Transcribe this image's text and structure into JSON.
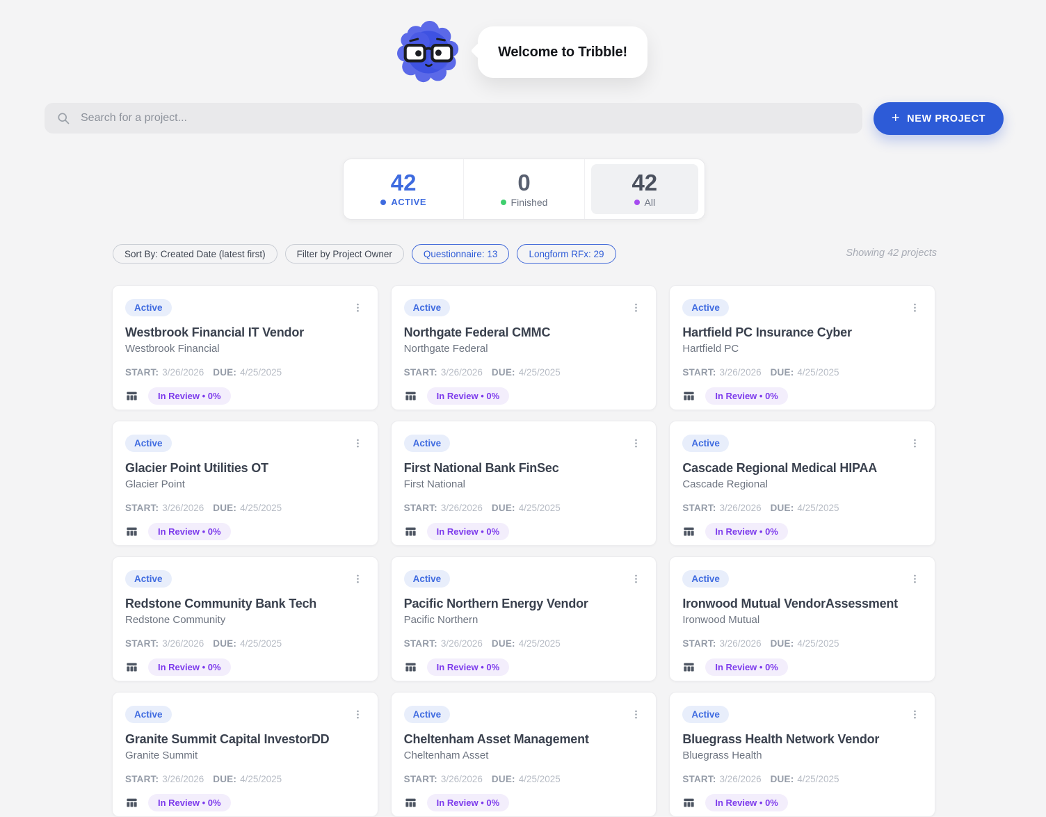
{
  "header": {
    "welcome_text": "Welcome to Tribble!"
  },
  "toolbar": {
    "search_placeholder": "Search for a project...",
    "new_project_label": "NEW PROJECT",
    "plus_glyph": "+"
  },
  "stats": {
    "active": {
      "value": "42",
      "label": "ACTIVE"
    },
    "finished": {
      "value": "0",
      "label": "Finished"
    },
    "all": {
      "value": "42",
      "label": "All"
    }
  },
  "filters": {
    "sort_chip": "Sort By: Created Date (latest first)",
    "owner_chip": "Filter by Project Owner",
    "questionnaire_chip": "Questionnaire: 13",
    "longform_chip": "Longform RFx: 29",
    "showing_text": "Showing 42 projects"
  },
  "projects": {
    "status_label": "Active",
    "start_label": "START:",
    "start_date": "3/26/2026",
    "due_label": "DUE:",
    "due_date": "4/25/2025",
    "progress_label": "In Review • 0%",
    "cards": [
      {
        "title": "Westbrook Financial IT Vendor",
        "subtitle": "Westbrook Financial"
      },
      {
        "title": "Northgate Federal CMMC",
        "subtitle": "Northgate Federal"
      },
      {
        "title": "Hartfield PC Insurance Cyber",
        "subtitle": "Hartfield PC"
      },
      {
        "title": "Glacier Point Utilities OT",
        "subtitle": "Glacier Point"
      },
      {
        "title": "First National Bank FinSec",
        "subtitle": "First National"
      },
      {
        "title": "Cascade Regional Medical HIPAA",
        "subtitle": "Cascade Regional"
      },
      {
        "title": "Redstone Community Bank Tech",
        "subtitle": "Redstone Community"
      },
      {
        "title": "Pacific Northern Energy Vendor",
        "subtitle": "Pacific Northern"
      },
      {
        "title": "Ironwood Mutual VendorAssessment",
        "subtitle": "Ironwood Mutual"
      },
      {
        "title": "Granite Summit Capital InvestorDD",
        "subtitle": "Granite Summit"
      },
      {
        "title": "Cheltenham Asset Management",
        "subtitle": "Cheltenham Asset"
      },
      {
        "title": "Bluegrass Health Network Vendor",
        "subtitle": "Bluegrass Health"
      }
    ]
  },
  "colors": {
    "page_bg": "#f4f4f5",
    "accent_blue": "#2d5bd7",
    "stat_active_blue": "#3e6bdf",
    "finished_green": "#3fcf6e",
    "all_purple": "#a64cf0",
    "badge_blue_bg": "#e8eefb",
    "badge_blue_text": "#3f6be0",
    "review_pill_bg": "#f3eefc",
    "review_purple": "#7d3bec",
    "mascot_blue_dark": "#3e52e2",
    "mascot_blue_light": "#5b69e8"
  },
  "icons": {
    "search": "search-icon",
    "plus": "plus-icon",
    "kebab": "kebab-menu-icon",
    "table": "table-icon",
    "mascot": "tribble-mascot"
  }
}
